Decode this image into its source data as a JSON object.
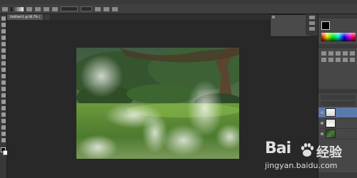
{
  "document": {
    "tabs": [
      {
        "label": "Untitled-1 @ 66.7% ("
      },
      {
        "label": ""
      }
    ]
  },
  "history": {
    "title": "",
    "items": [
      {
        "label": ""
      },
      {
        "label": ""
      },
      {
        "label": ""
      },
      {
        "label": ""
      }
    ]
  },
  "color_panel": {
    "tabs": [
      {
        "label": ""
      },
      {
        "label": ""
      }
    ]
  },
  "layers": {
    "rows": [
      {
        "name": ""
      },
      {
        "name": ""
      },
      {
        "name": ""
      }
    ]
  },
  "watermark": {
    "brand_latin": "Bai",
    "brand_cn": "经验",
    "url": "jingyan.baidu.com"
  },
  "colors": {
    "foreground": "#000000",
    "background": "#ffffff",
    "selection": "#5b7aa8"
  }
}
